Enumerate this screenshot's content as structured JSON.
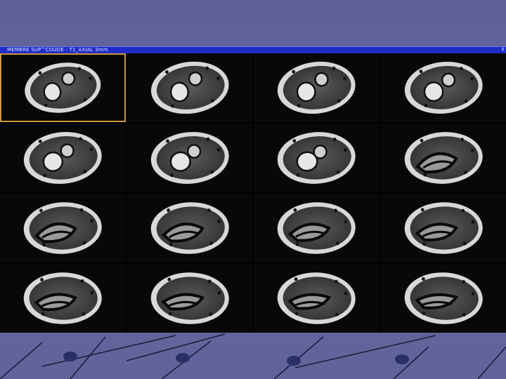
{
  "viewer": {
    "title": "MEMBRE SUP^COUDE - T1_AXIAL 3mm",
    "right_marker": "F"
  },
  "series": {
    "rows": 4,
    "columns": 4,
    "selected_index": 0,
    "slice_count": 16
  },
  "colors": {
    "background": "#6a6ea4",
    "title_bar": "#1f2cc8",
    "selection_border": "#c79a3a",
    "viewer_bg": "#000000"
  }
}
